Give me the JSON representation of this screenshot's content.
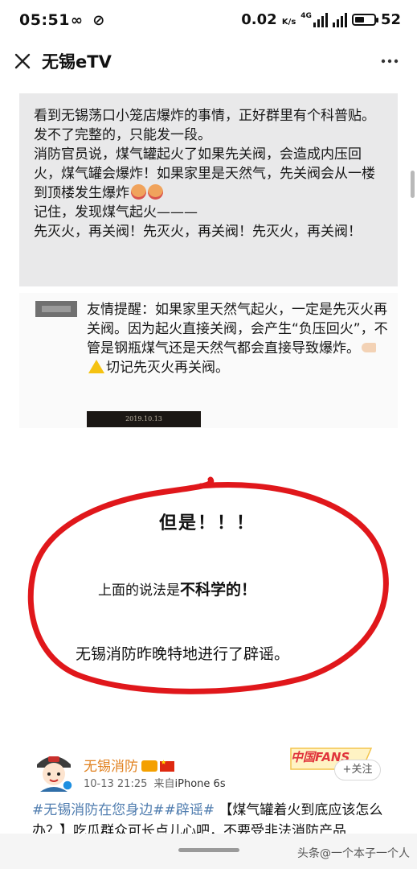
{
  "status_bar": {
    "time": "05:51",
    "icons_left": [
      "infinity-icon",
      "no-disturb-icon"
    ],
    "speed": "0.02",
    "speed_unit": "K/s",
    "network": "4G",
    "battery": "52",
    "battery_level": 0.52
  },
  "header": {
    "title": "无锡eTV",
    "close_icon": "close-icon",
    "more_icon": "more-icon"
  },
  "card1": {
    "lines": [
      "看到无锡荡口小笼店爆炸的事情，正好群里有个科普贴。发不了完整的，只能发一段。",
      "消防官员说，煤气罐起火了如果先关阀，会造成内压回火，煤气罐会爆炸！如果家里是天然气，先关阀会从一楼到顶楼发生爆炸",
      "记住，发现煤气起火———",
      "先灭火，再关阀！先灭火，再关阀！先灭火，再关阀！"
    ]
  },
  "card2": {
    "text_a": "友情提醒：如果家里天然气起火，一定是先灭火再关阀。因为起火直接关阀，会产生“负压回火”，不管是钢瓶煤气还是天然气都会直接导致爆炸。",
    "text_b": "切记先灭火再关阀。",
    "video_date": "2019.10.13"
  },
  "highlight": {
    "but": "但是！！！",
    "unscientific_prefix": "上面的说法是",
    "unscientific_bold": "不科学的！",
    "rumor": "无锡消防昨晚特地进行了辟谣。",
    "circle_color": "#e0171b"
  },
  "weibo": {
    "name": "无锡消防",
    "time": "10-13 21:25",
    "source_prefix": "来自",
    "source": "iPhone 6s",
    "fans_label": "中国FANS",
    "follow_label": "+关注",
    "hashtag1": "#无锡消防在您身边#",
    "hashtag2": "#辟谣#",
    "text": "【煤气罐着火到底应该怎么办？】吃瓜群众可长点儿心吧，不要受非法消防产品"
  },
  "footer": {
    "watermark": "头条@一个本子一个人"
  }
}
